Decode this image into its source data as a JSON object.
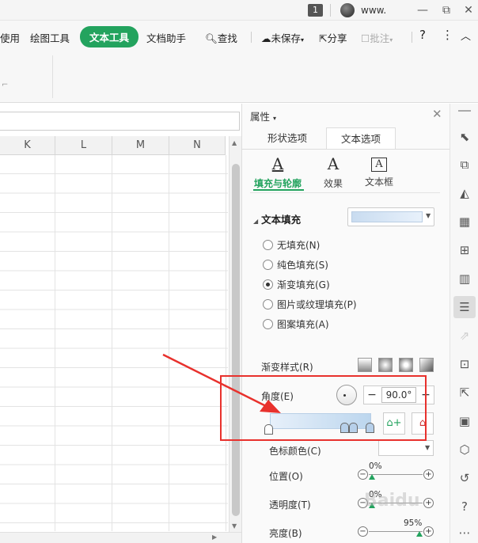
{
  "titlebar": {
    "badge": "1",
    "user": "www.",
    "minimize": "—",
    "restore": "⧉",
    "close": "✕"
  },
  "menubar": {
    "items": [
      "使用",
      "绘图工具",
      "文本工具",
      "文档助手",
      "查找",
      "未保存",
      "分享",
      "批注",
      "?",
      "⋮",
      "︿"
    ],
    "active": "文本工具"
  },
  "sheet": {
    "columns": [
      "K",
      "L",
      "M",
      "N"
    ]
  },
  "panel": {
    "title": "属性",
    "close": "✕",
    "tabs": [
      "形状选项",
      "文本选项"
    ],
    "active_tab": "文本选项",
    "subtabs": [
      {
        "glyph": "A",
        "label": "填充与轮廓"
      },
      {
        "glyph": "A",
        "label": "效果"
      },
      {
        "glyph": "A",
        "label": "文本框"
      }
    ],
    "section": "文本填充",
    "fill_options": [
      "无填充(N)",
      "纯色填充(S)",
      "渐变填充(G)",
      "图片或纹理填充(P)",
      "图案填充(A)"
    ],
    "selected_fill": "渐变填充(G)",
    "gradient_style_label": "渐变样式(R)",
    "angle_label": "角度(E)",
    "angle_value": "90.0°",
    "stop_color_label": "色标颜色(C)",
    "position_label": "位置(O)",
    "position_value": "0%",
    "transparency_label": "透明度(T)",
    "transparency_value": "0%",
    "brightness_label": "亮度(B)",
    "brightness_value": "95%",
    "colors": {
      "accent": "#23a35e",
      "highlight": "#e8312d"
    }
  },
  "watermark": "Baidu"
}
